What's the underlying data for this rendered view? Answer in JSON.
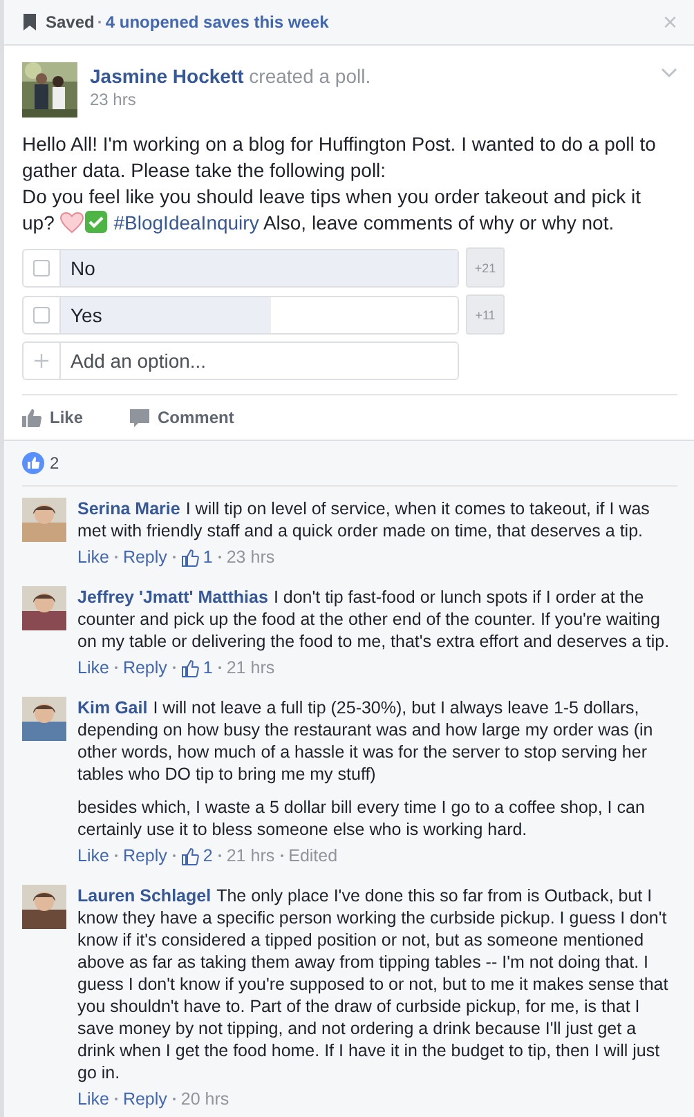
{
  "saved_bar": {
    "label": "Saved",
    "link": "4 unopened saves this week",
    "close": "×"
  },
  "post": {
    "author": "Jasmine Hockett",
    "action": "created a poll.",
    "time": "23 hrs",
    "body": [
      {
        "kind": "text",
        "text": "Hello All! I'm working on a blog for Huffington Post. I wanted to do a poll to gather data. Please take the following poll:"
      },
      {
        "kind": "break"
      },
      {
        "kind": "text",
        "text": "Do you feel like you should leave tips when you order takeout and pick it up? "
      },
      {
        "kind": "heart"
      },
      {
        "kind": "check"
      },
      {
        "kind": "hashtag",
        "text": "#BlogIdeaInquiry"
      },
      {
        "kind": "text",
        "text": " Also, leave comments of why or why not."
      }
    ],
    "poll": [
      {
        "label": "No",
        "checked": false,
        "level": 1.0,
        "count": "+21"
      },
      {
        "label": "Yes",
        "checked": false,
        "level": 0.53,
        "count": "+11"
      }
    ],
    "add_option": {
      "placeholder": "Add an option..."
    },
    "actions": [
      {
        "kind": "like",
        "label": "Like"
      },
      {
        "kind": "comment",
        "label": "Comment"
      }
    ],
    "reactions": "2"
  },
  "comments": [
    {
      "name": "Serina Marie",
      "paragraphs": [
        "I will tip on level of service, when it comes to takeout, if I was met with friendly staff and a quick order made on time, that deserves a tip."
      ],
      "like": "Like",
      "reply": "Reply",
      "likes": "1",
      "time": "23 hrs"
    },
    {
      "name": "Jeffrey 'Jmatt' Matthias",
      "paragraphs": [
        "I don't tip fast-food or lunch spots if I order at the counter and pick up the food at the other end of the counter. If you're waiting on my table or delivering the food to me, that's extra effort and deserves a tip."
      ],
      "like": "Like",
      "reply": "Reply",
      "likes": "1",
      "time": "21 hrs"
    },
    {
      "name": "Kim Gail",
      "paragraphs": [
        "I will not leave a full tip (25-30%), but I always leave 1-5 dollars, depending on how busy the restaurant was and how large my order was (in other words, how much of a hassle it was for the server to stop serving her tables who DO tip to bring me my stuff)",
        "besides which, I waste a 5 dollar bill every time I go to a coffee shop, I can certainly use it to bless someone else who is working hard."
      ],
      "like": "Like",
      "reply": "Reply",
      "likes": "2",
      "time": "21 hrs",
      "edited": "Edited"
    },
    {
      "name": "Lauren Schlagel",
      "paragraphs": [
        "The only place I've done this so far from is Outback, but I know they have a specific person working the curbside pickup. I guess I don't know if it's considered a tipped position or not, but as someone mentioned above as far as taking them away from tipping tables -- I'm not doing that. I guess I don't know if you're supposed to or not, but to me it makes sense that you shouldn't have to. Part of the draw of curbside pickup, for me, is that I save money by not tipping, and not ordering a drink because I'll just get a drink when I get the food home. If I have it in the budget to tip, then I will just go in."
      ],
      "like": "Like",
      "reply": "Reply",
      "time": "20 hrs"
    }
  ]
}
